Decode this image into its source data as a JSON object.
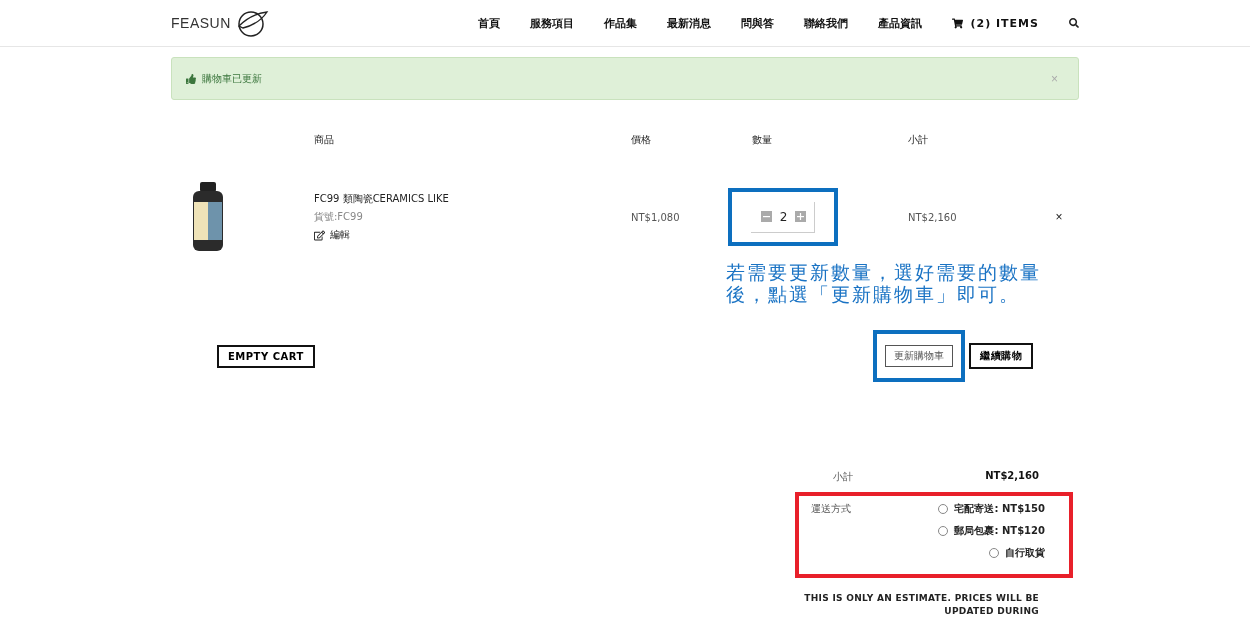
{
  "header": {
    "logo": "FEASUN",
    "nav": [
      "首頁",
      "服務項目",
      "作品集",
      "最新消息",
      "問與答",
      "聯絡我們",
      "產品資訊"
    ],
    "cart": "(2) ITEMS"
  },
  "alert": {
    "message": "購物車已更新",
    "close": "×"
  },
  "table": {
    "columns": [
      "商品",
      "價格",
      "數量",
      "小計"
    ],
    "rows": [
      {
        "name": "FC99 類陶瓷CERAMICS LIKE",
        "sku": "貨號:FC99",
        "edit": "編輯",
        "price": "NT$1,080",
        "quantity": "2",
        "subtotal": "NT$2,160",
        "remove": "×"
      }
    ]
  },
  "annotation": "若需要更新數量，選好需要的數量後，點選「更新購物車」即可。",
  "buttons": {
    "empty": "EMPTY CART",
    "update": "更新購物車",
    "continue": "繼續購物"
  },
  "totals": {
    "subtotal_label": "小計",
    "subtotal": "NT$2,160",
    "shipping_label": "運送方式",
    "shipping_options": [
      {
        "label": "宅配寄送: NT$150",
        "selected": false
      },
      {
        "label": "郵局包裹: NT$120",
        "selected": false
      },
      {
        "label": "自行取貨",
        "selected": false
      }
    ],
    "note": "THIS IS ONLY AN ESTIMATE. PRICES WILL BE UPDATED DURING"
  }
}
